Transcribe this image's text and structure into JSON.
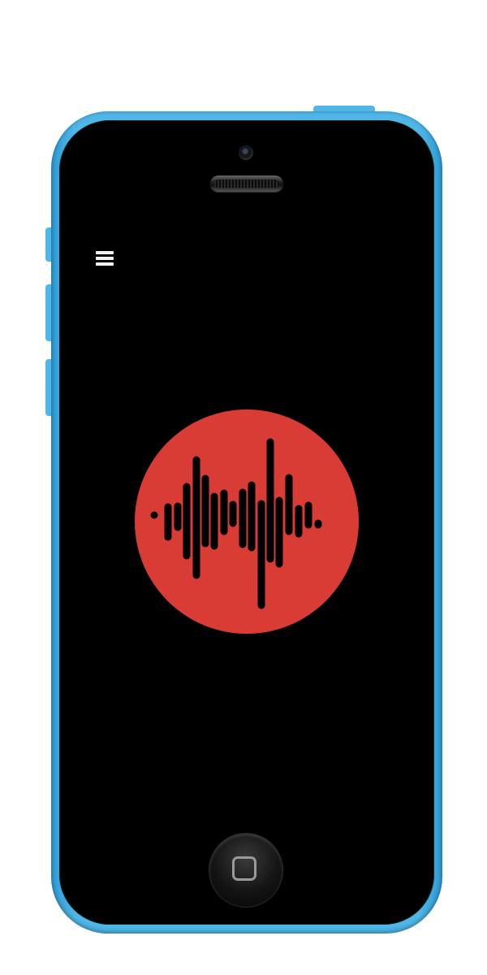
{
  "device": {
    "body_color": "#4fb7e8",
    "body_color_dark": "#2e9bd6",
    "model": "phone-device"
  },
  "app": {
    "background": "#000000",
    "menu_icon": "hamburger-menu-icon",
    "record_button": {
      "icon": "sound-wave-icon",
      "color": "#d93b35",
      "wave_color": "#000000"
    }
  },
  "home_button": {
    "icon": "home-square-icon"
  }
}
